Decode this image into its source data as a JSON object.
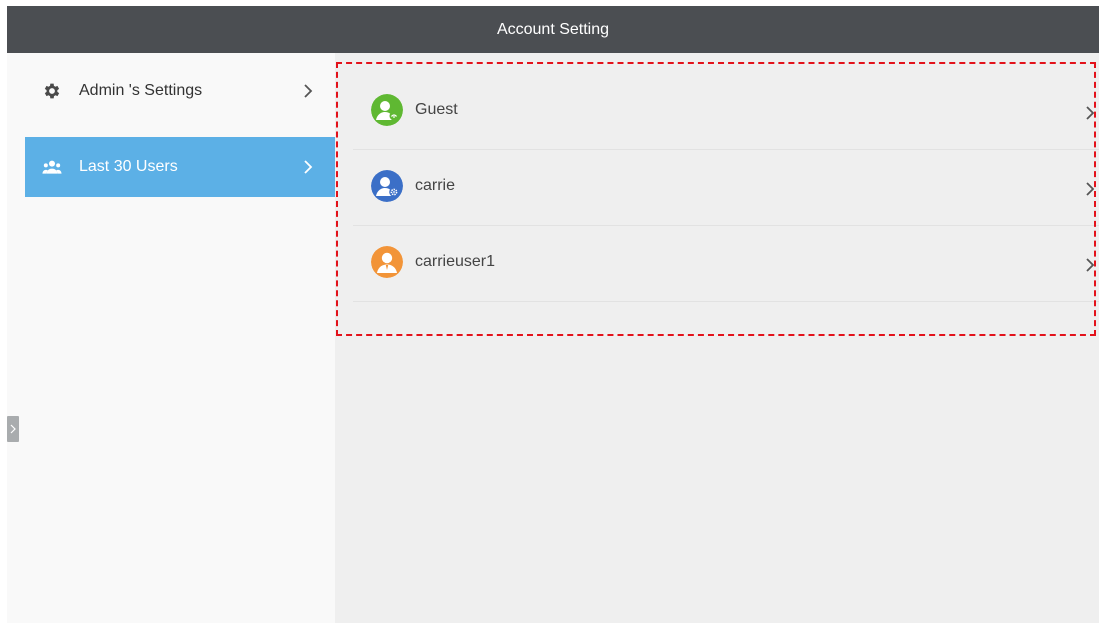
{
  "titlebar": {
    "title": "Account Setting"
  },
  "sidebar": {
    "items": [
      {
        "label": "Admin 's Settings",
        "icon": "gear-icon",
        "active": false
      },
      {
        "label": "Last 30 Users",
        "icon": "users-icon",
        "active": true
      }
    ]
  },
  "users": [
    {
      "name": "Guest",
      "avatar_color": "#5fb832",
      "avatar_icon": "guest-avatar-icon"
    },
    {
      "name": "carrie",
      "avatar_color": "#3b6fc7",
      "avatar_icon": "admin-avatar-icon"
    },
    {
      "name": "carrieuser1",
      "avatar_color": "#f29438",
      "avatar_icon": "user-avatar-icon"
    }
  ],
  "colors": {
    "titlebar_bg": "#4b4e52",
    "active_item_bg": "#5cb0e6",
    "highlight_border": "#e3121b"
  }
}
